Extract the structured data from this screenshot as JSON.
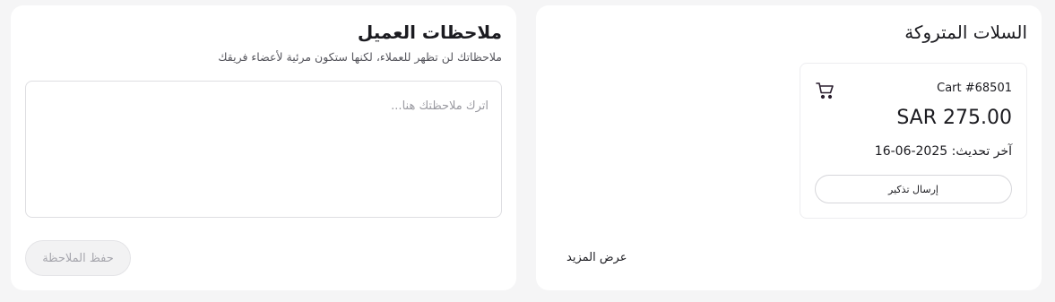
{
  "abandoned_carts": {
    "title": "السلات المتروكة",
    "show_more_label": "عرض المزيد",
    "cart": {
      "id_label": "Cart #68501",
      "total": "SAR 275.00",
      "updated_prefix": "آخر تحديث:",
      "updated_date": "16-06-2025",
      "reminder_label": "إرسال تذكير",
      "icon": "shopping-cart-icon"
    }
  },
  "customer_notes": {
    "title": "ملاحظات العميل",
    "subtitle": "ملاحظاتك لن تظهر للعملاء، لكنها ستكون مرئية لأعضاء فريقك",
    "textarea_placeholder": "اترك ملاحظتك هنا...",
    "textarea_value": "",
    "save_label": "حفظ الملاحظة"
  },
  "colors": {
    "page_background": "#f5f5f6",
    "card_background": "#ffffff",
    "text_primary": "#1b1b20",
    "disabled_text": "#a6a6ad"
  }
}
